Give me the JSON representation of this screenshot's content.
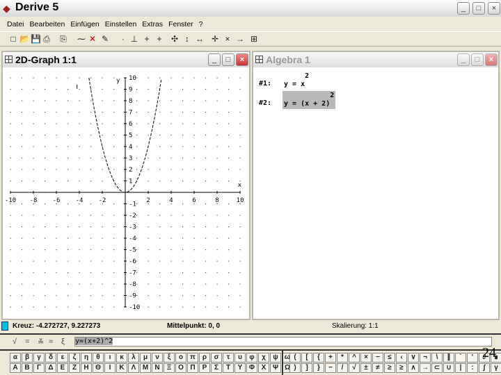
{
  "app": {
    "title": "Derive 5"
  },
  "menu": [
    "Datei",
    "Bearbeiten",
    "Einfügen",
    "Einstellen",
    "Extras",
    "Fenster",
    "?"
  ],
  "toolbar_icons": [
    "new-icon",
    "open-icon",
    "save-icon",
    "print-icon",
    "copy-icon",
    "pencil-icon",
    "delete-icon",
    "edit-icon",
    "trace-icon",
    "axes-icon",
    "cross-icon",
    "plus-icon",
    "zoom-both-icon",
    "zoom-vertical-icon",
    "zoom-horizontal-icon",
    "center-icon",
    "zoom-in-icon",
    "zoom-out-icon",
    "grid-icon"
  ],
  "graph_window": {
    "title": "2D-Graph 1:1"
  },
  "algebra_window": {
    "title": "Algebra 1",
    "expressions": [
      {
        "label": "#1:",
        "lhs": "y = x",
        "exp": "2",
        "highlighted": false
      },
      {
        "label": "#2:",
        "lhs": "y = (x + 2)",
        "exp": "2",
        "highlighted": true
      }
    ]
  },
  "chart_data": {
    "type": "line",
    "function": "y = x^2",
    "xlim": [
      -10,
      10
    ],
    "ylim": [
      -10,
      10
    ],
    "xticks": [
      -10,
      -8,
      -6,
      -4,
      -2,
      2,
      4,
      6,
      8,
      10
    ],
    "yticks": [
      10,
      9,
      8,
      7,
      6,
      5,
      4,
      3,
      2,
      1,
      -1,
      -2,
      -3,
      -4,
      -5,
      -6,
      -7,
      -8,
      -9,
      -10
    ],
    "xlabel": "x",
    "ylabel": "y",
    "grid": "dots",
    "cursor": [
      -4.2,
      9.22
    ],
    "line_style": "dashed"
  },
  "status": {
    "cross": "Kreuz: -4.272727, 9.227273",
    "center": "Mittelpunkt: 0, 0",
    "scale": "Skalierung: 1:1",
    "accent": "#00c0e0"
  },
  "entry": {
    "value": "y=(x+2)^2",
    "icons": [
      "simplify-icon",
      "approximate-icon",
      "solve-icon",
      "equals-icon",
      "vector-icon"
    ]
  },
  "greek_lower": [
    "α",
    "β",
    "γ",
    "δ",
    "ε",
    "ζ",
    "η",
    "θ",
    "ι",
    "κ",
    "λ",
    "μ",
    "ν",
    "ξ",
    "ο",
    "π",
    "ρ",
    "σ",
    "τ",
    "υ",
    "φ",
    "χ",
    "ψ",
    "ω"
  ],
  "greek_upper": [
    "Α",
    "Β",
    "Γ",
    "Δ",
    "Ε",
    "Ζ",
    "Η",
    "Θ",
    "Ι",
    "Κ",
    "Λ",
    "Μ",
    "Ν",
    "Ξ",
    "Ο",
    "Π",
    "Ρ",
    "Σ",
    "Τ",
    "Υ",
    "Φ",
    "Χ",
    "Ψ",
    "Ω"
  ],
  "ops_top": [
    "(",
    "[",
    "{",
    "+",
    "*",
    "^",
    "×",
    "−",
    "≤",
    "‹",
    "∨",
    "¬",
    "\\",
    "∥",
    "`",
    "'",
    "∂",
    "∎",
    "∞"
  ],
  "ops_bottom": [
    ")",
    "]",
    "}",
    "−",
    "/",
    "√",
    "±",
    "≠",
    "≥",
    "≥",
    "∧",
    "→",
    "⊂",
    "∪",
    "|",
    ":",
    "∫",
    "γ",
    "°"
  ],
  "page_number": "24"
}
